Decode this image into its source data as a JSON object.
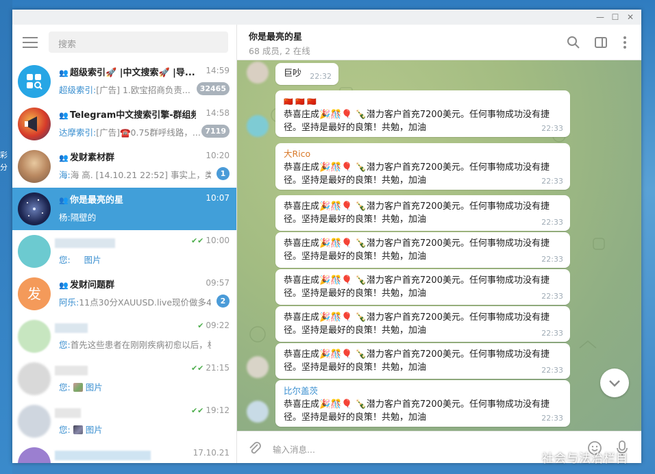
{
  "window": {
    "controls": [
      "minimize-icon",
      "maximize-icon",
      "close-icon"
    ]
  },
  "desktop": {
    "fragments": [
      "彩",
      "分"
    ]
  },
  "sidebar": {
    "search_placeholder": "搜索",
    "chats": [
      {
        "name": "超级索引🚀 |中文搜索🚀 |导...",
        "time": "14:59",
        "sender": "超级索引:",
        "preview": "[广告] 1.欧宝招商负责...",
        "badge": "32465",
        "badge_style": "muted",
        "is_group": true
      },
      {
        "name": "Telegram中文搜索引擎-群组频...",
        "time": "14:58",
        "sender": "达摩索引:",
        "preview": "[广告]☎️0.75群呼线路，...",
        "badge": "7119",
        "badge_style": "muted",
        "is_group": true
      },
      {
        "name": "发财素材群",
        "time": "10:20",
        "sender": "海:",
        "preview": "海 高. [14.10.21 22:52] 事实上，类...",
        "badge": "1",
        "badge_style": "blue",
        "is_group": true
      },
      {
        "name": "你是最亮的星",
        "time": "10:07",
        "sender": "杨:",
        "preview": "隔壁的",
        "is_group": true,
        "active": true
      },
      {
        "name": "",
        "time": "10:00",
        "sender": "您:",
        "preview": "图片",
        "read": "double"
      },
      {
        "name": "发财问题群",
        "time": "09:57",
        "avatar_char": "发",
        "sender": "阿乐:",
        "preview": "11点30分XAUUSD.live现价做多4...",
        "badge": "2",
        "badge_style": "blue",
        "is_group": true
      },
      {
        "name": "",
        "time": "09:22",
        "sender": "您:",
        "preview": "首先这些患者在刚刚疾病初愈以后，机...",
        "read": "single"
      },
      {
        "name": "",
        "time": "21:15",
        "sender": "您:",
        "preview": "图片",
        "read": "double"
      },
      {
        "name": "",
        "time": "19:12",
        "sender": "您:",
        "preview": "图片",
        "read": "double"
      },
      {
        "name": "",
        "time": "17.10.21"
      }
    ]
  },
  "header": {
    "title": "你是最亮的星",
    "subtitle": "68 成员, 2 在线"
  },
  "messages": [
    {
      "text": "巨吵",
      "time": "22:32"
    },
    {
      "line0": "🇨🇳 🇨🇳 🇨🇳",
      "line1": "恭喜庄成🎉🎊🎈 🍾潜力客户首充7200美元。任何事物成功没有捷",
      "line2": "径。坚持是最好的良策！共勉，加油",
      "time": "22:33"
    },
    {
      "sender": "大Rico",
      "line1": "恭喜庄成🎉🎊🎈 🍾潜力客户首充7200美元。任何事物成功没有捷",
      "line2": "径。坚持是最好的良策！共勉，加油",
      "time": "22:33"
    },
    {
      "line1": "恭喜庄成🎉🎊🎈 🍾潜力客户首充7200美元。任何事物成功没有捷",
      "line2": "径。坚持是最好的良策！共勉，加油",
      "time": "22:33"
    },
    {
      "line1": "恭喜庄成🎉🎊🎈 🍾潜力客户首充7200美元。任何事物成功没有捷",
      "line2": "径。坚持是最好的良策！共勉，加油",
      "time": "22:33"
    },
    {
      "line1": "恭喜庄成🎉🎊🎈 🍾潜力客户首充7200美元。任何事物成功没有捷",
      "line2": "径。坚持是最好的良策！共勉，加油",
      "time": "22:33"
    },
    {
      "line1": "恭喜庄成🎉🎊🎈 🍾潜力客户首充7200美元。任何事物成功没有捷",
      "line2": "径。坚持是最好的良策！共勉，加油",
      "time": "22:33"
    },
    {
      "line1": "恭喜庄成🎉🎊🎈 🍾潜力客户首充7200美元。任何事物成功没有捷",
      "line2": "径。坚持是最好的良策！共勉，加油",
      "time": "22:33"
    },
    {
      "sender": "比尔盖茨",
      "line1": "恭喜庄成🎉🎊🎈 🍾潜力客户首充7200美元。任何事物成功没有捷",
      "line2": "径。坚持是最好的良策！共勉，加油",
      "time": "22:33"
    }
  ],
  "composer": {
    "placeholder": "输入消息..."
  },
  "colors": {
    "accent": "#419fd9",
    "sender_orange": "#d97a2b",
    "sender_blue": "#3a8fd0",
    "read_tick": "#4fae4e"
  },
  "watermark": "社会与法治栏目"
}
